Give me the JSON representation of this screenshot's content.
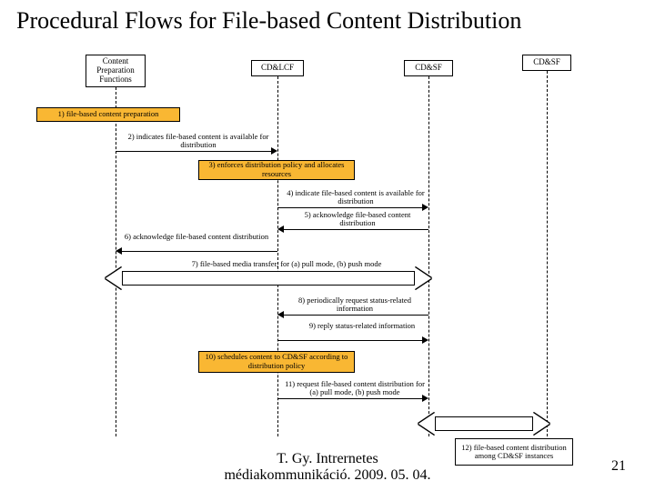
{
  "title": "Procedural Flows for File-based Content Distribution",
  "lanes": {
    "a": "Content Preparation Functions",
    "b": "CD&LCF",
    "c": "CD&SF",
    "d": "CD&SF"
  },
  "steps": {
    "s1": "1) file-based content preparation",
    "s2": "2) indicates file-based content is available for distribution",
    "s3": "3) enforces distribution policy and allocates resources",
    "s4": "4) indicate file-based content is available for distribution",
    "s5": "5) acknowledge file-based content distribution",
    "s6": "6) acknowledge file-based content distribution",
    "s7": "7) file-based media transfer, for (a) pull mode, (b) push mode",
    "s8": "8) periodically request status-related information",
    "s9": "9) reply status-related information",
    "s10": "10) schedules content to CD&SF according to distribution policy",
    "s11": "11) request file-based content distribution for (a) pull mode, (b) push mode",
    "s12": "12) file-based content distribution among CD&SF instances"
  },
  "footer": {
    "line1": "T. Gy. Intrernetes",
    "line2": "médiakommunikáció. 2009. 05. 04."
  },
  "page": "21"
}
